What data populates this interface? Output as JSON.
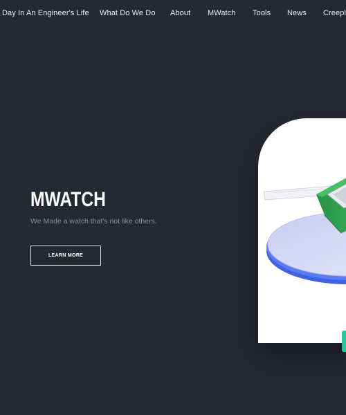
{
  "nav": {
    "items": [
      {
        "label": "Day In An Engineer's Life"
      },
      {
        "label": "What Do We Do"
      },
      {
        "label": "About"
      },
      {
        "label": "MWatch"
      },
      {
        "label": "Tools"
      },
      {
        "label": "News"
      },
      {
        "label": "Creeple"
      }
    ]
  },
  "hero": {
    "title": "MWATCH",
    "subtitle": "We Made a watch that's not like others.",
    "cta_label": "LEARN MORE"
  },
  "colors": {
    "background": "#262932",
    "accent": "#2bc39a",
    "watch_body": "#2e9c4f",
    "disc": "#4a73e8"
  },
  "icons": {
    "product_image": "watch-render-image"
  }
}
